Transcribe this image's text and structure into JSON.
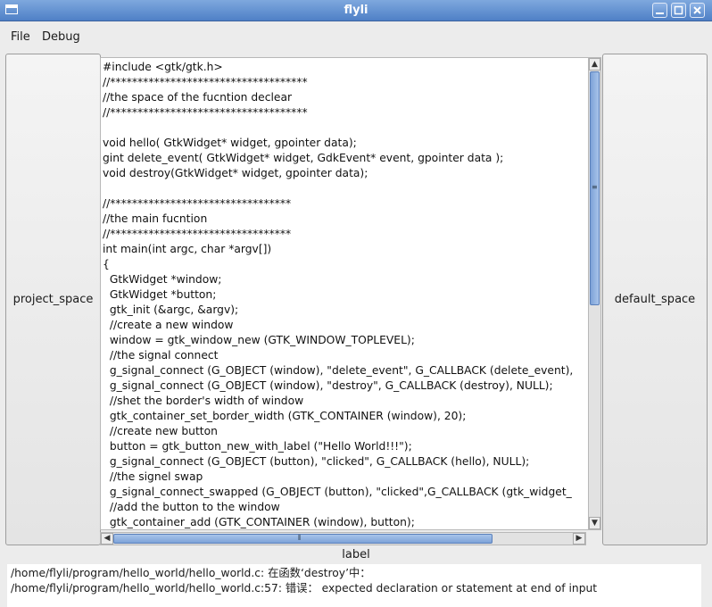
{
  "window": {
    "title": "flyli"
  },
  "menubar": {
    "items": [
      {
        "label": "File"
      },
      {
        "label": "Debug"
      }
    ]
  },
  "left_panel": {
    "label": "project_space"
  },
  "right_panel": {
    "label": "default_space"
  },
  "editor": {
    "lines": [
      "#include <gtk/gtk.h>",
      "//************************************",
      "//the space of the fucntion declear",
      "//************************************",
      "",
      "void hello( GtkWidget* widget, gpointer data);",
      "gint delete_event( GtkWidget* widget, GdkEvent* event, gpointer data );",
      "void destroy(GtkWidget* widget, gpointer data);",
      "",
      "//*********************************",
      "//the main fucntion",
      "//*********************************",
      "int main(int argc, char *argv[])",
      "{",
      "  GtkWidget *window;",
      "  GtkWidget *button;",
      "  gtk_init (&argc, &argv);",
      "  //create a new window",
      "  window = gtk_window_new (GTK_WINDOW_TOPLEVEL);",
      "  //the signal connect",
      "  g_signal_connect (G_OBJECT (window), \"delete_event\", G_CALLBACK (delete_event),",
      "  g_signal_connect (G_OBJECT (window), \"destroy\", G_CALLBACK (destroy), NULL);",
      "  //shet the border's width of window",
      "  gtk_container_set_border_width (GTK_CONTAINER (window), 20);",
      "  //create new button",
      "  button = gtk_button_new_with_label (\"Hello World!!!\");",
      "  g_signal_connect (G_OBJECT (button), \"clicked\", G_CALLBACK (hello), NULL);",
      "  //the signel swap",
      "  g_signal_connect_swapped (G_OBJECT (button), \"clicked\",G_CALLBACK (gtk_widget_",
      "  //add the button to the window",
      "  gtk_container_add (GTK_CONTAINER (window), button);"
    ]
  },
  "status": {
    "label": "label",
    "output_lines": [
      "/home/flyli/program/hello_world/hello_world.c: 在函数‘destroy’中：",
      "/home/flyli/program/hello_world/hello_world.c:57: 错误： expected declaration or statement at end of input"
    ]
  },
  "colors": {
    "titlebar": "#5a8acc",
    "scroll_thumb": "#7ea3d8"
  }
}
